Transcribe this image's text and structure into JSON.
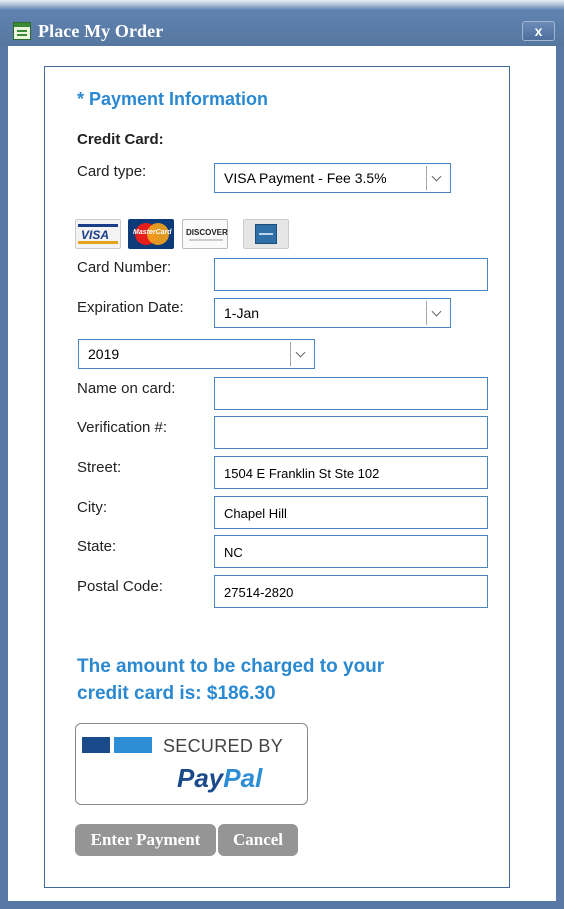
{
  "window": {
    "title": "Place My Order",
    "close_label": "x"
  },
  "form": {
    "section_title": "* Payment Information",
    "credit_card_heading": "Credit Card:",
    "card_type": {
      "label": "Card type:",
      "value": "VISA Payment - Fee 3.5%"
    },
    "card_logos": {
      "visa": {
        "icon": "visa-logo",
        "text": "VISA"
      },
      "mastercard": {
        "icon": "mastercard-logo",
        "text": "MasterCard"
      },
      "discover": {
        "icon": "discover-logo",
        "text": "DISCOVER"
      },
      "amex": {
        "icon": "amex-logo"
      }
    },
    "card_number": {
      "label": "Card Number:",
      "value": ""
    },
    "expiration": {
      "label": "Expiration Date:",
      "month_value": "1-Jan",
      "year_value": "2019"
    },
    "name_on_card": {
      "label": "Name on card:",
      "value": ""
    },
    "verification": {
      "label": "Verification #:",
      "value": ""
    },
    "street": {
      "label": "Street:",
      "value": "1504 E Franklin St Ste 102"
    },
    "city": {
      "label": "City:",
      "value": "Chapel Hill"
    },
    "state": {
      "label": "State:",
      "value": "NC"
    },
    "postal_code": {
      "label": "Postal Code:",
      "value": "27514-2820"
    }
  },
  "amount_line1": "The amount to be charged to your",
  "amount_line2": "credit card is: $186.30",
  "paypal": {
    "secured_text": "SECURED BY",
    "brand_pay": "Pay",
    "brand_pal": "Pal"
  },
  "buttons": {
    "enter_payment": "Enter Payment",
    "cancel": "Cancel"
  },
  "colors": {
    "accent": "#2a89d0",
    "title_bar": "#5878a6",
    "button": "#959595",
    "paypal_dark": "#1a4a8a",
    "paypal_light": "#2d8ed6"
  }
}
